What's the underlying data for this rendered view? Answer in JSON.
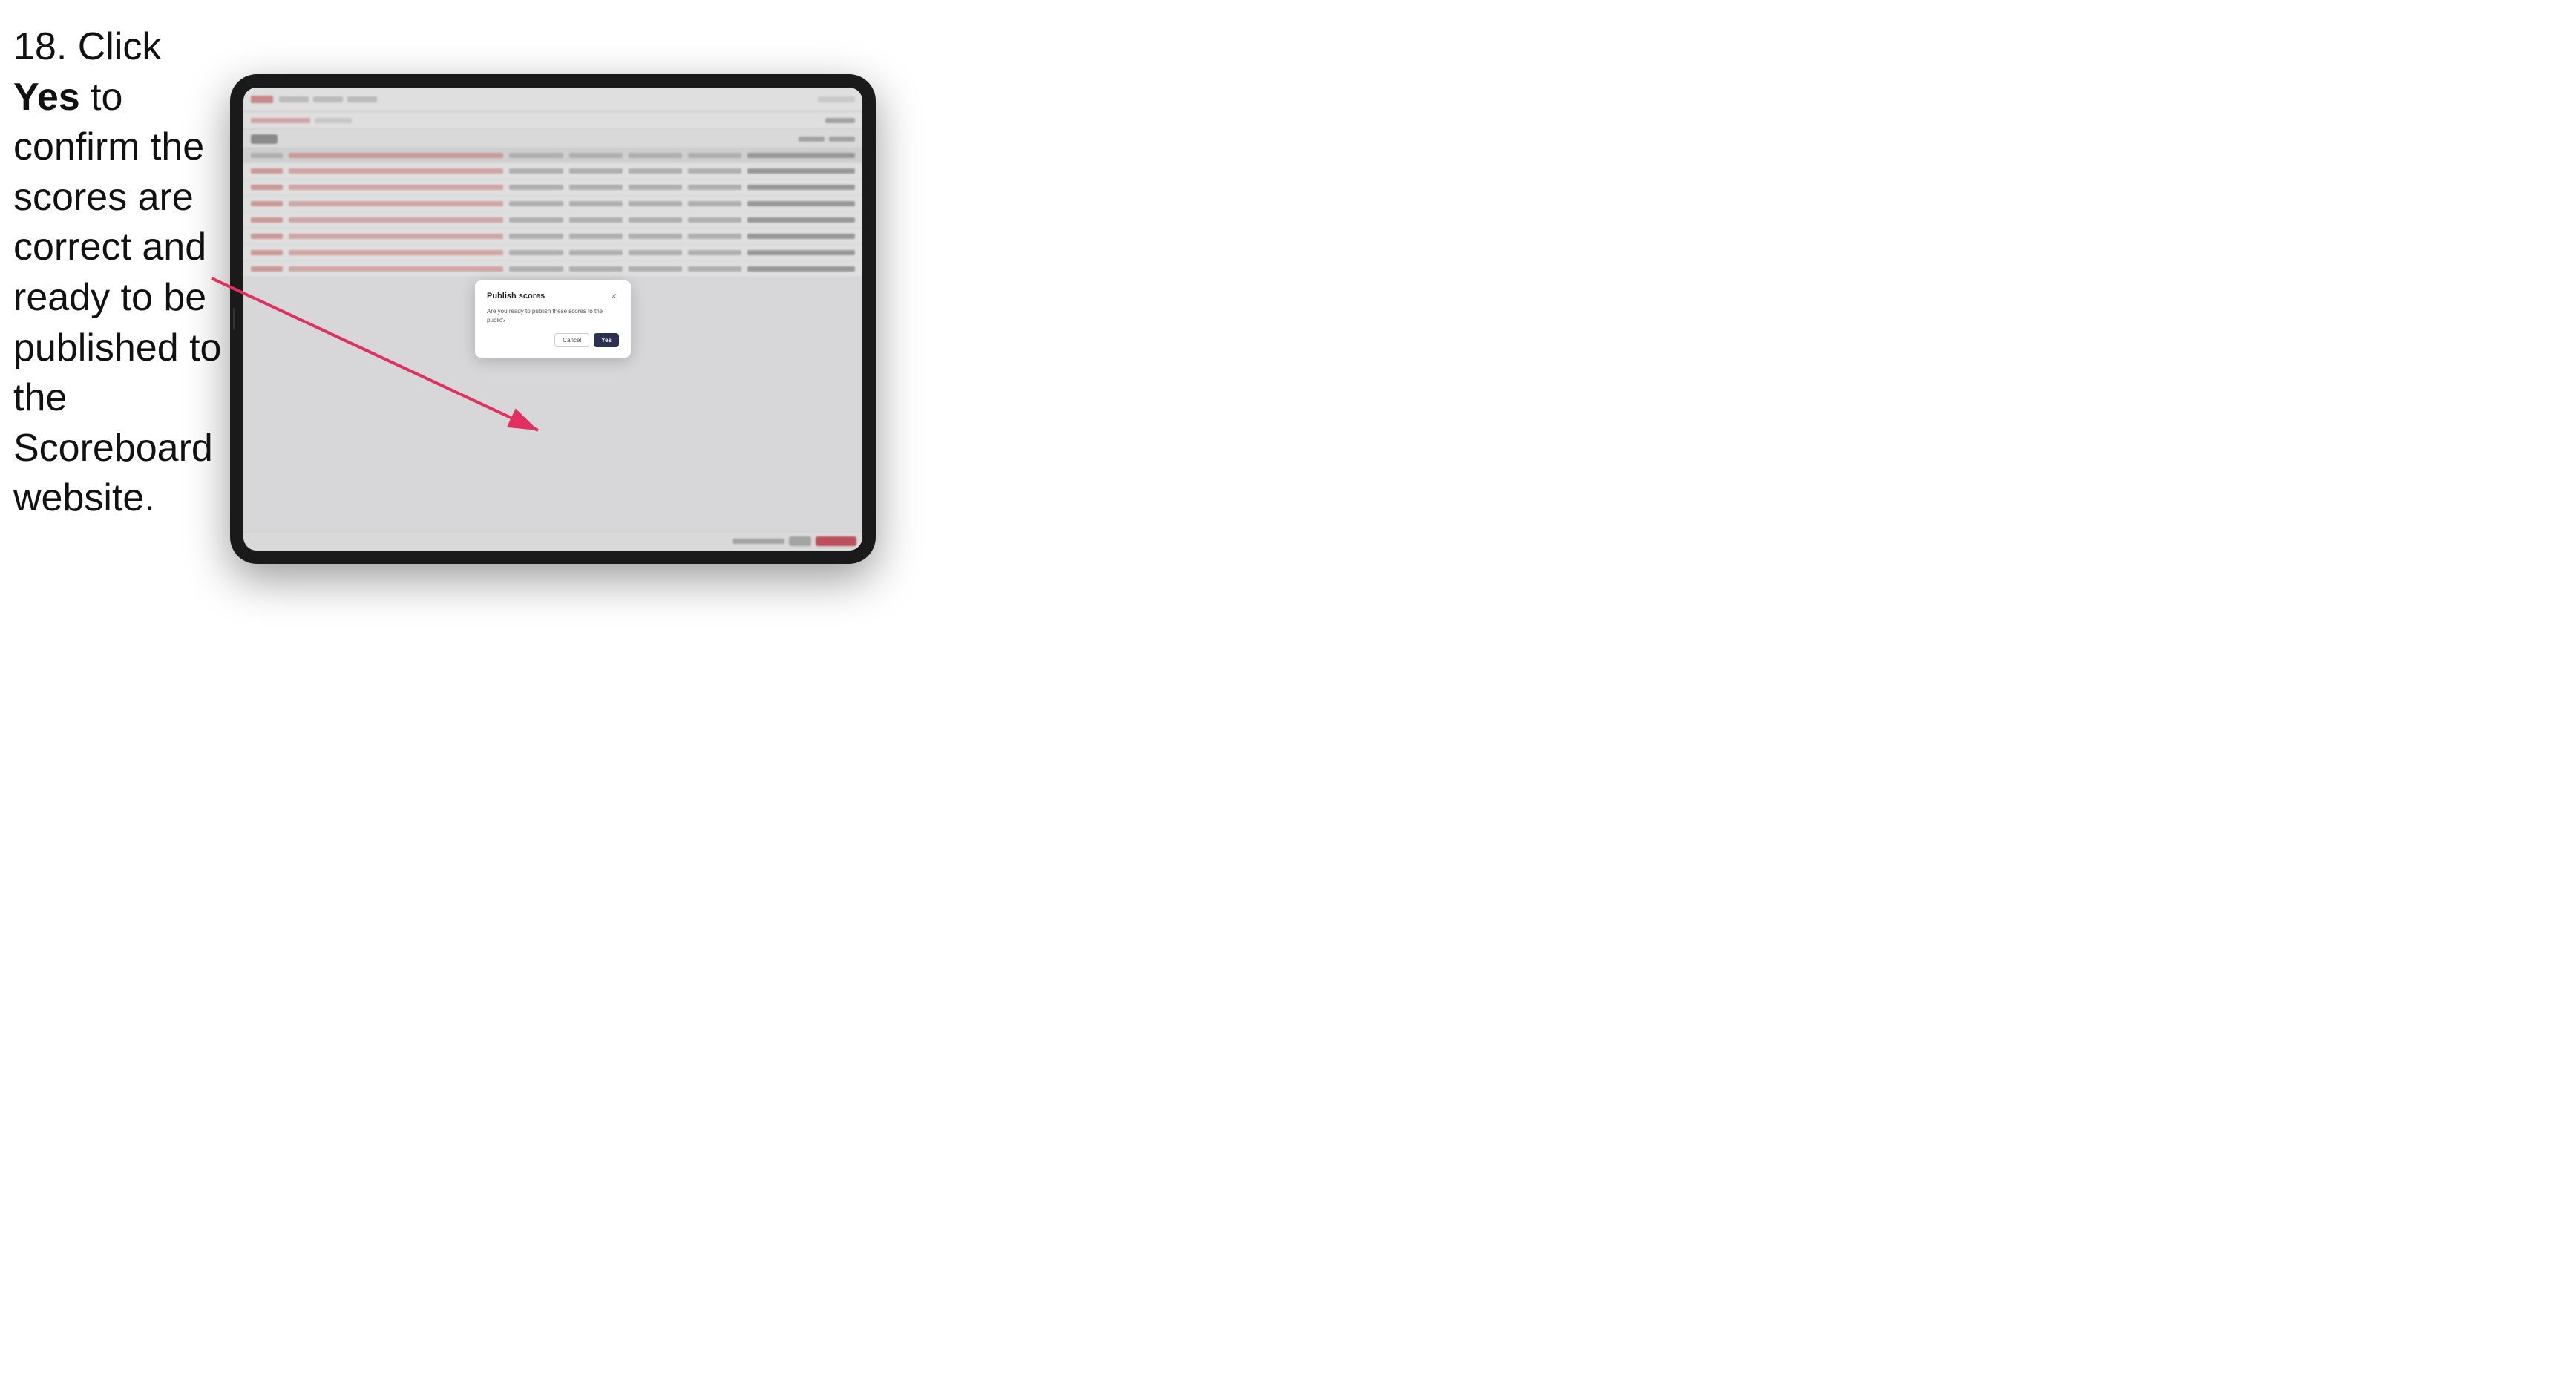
{
  "instruction": {
    "step_number": "18.",
    "text_pre": " Click ",
    "text_bold": "Yes",
    "text_post": " to confirm the scores are correct and ready to be published to the Scoreboard website."
  },
  "dialog": {
    "title": "Publish scores",
    "body": "Are you ready to publish these scores to the public?",
    "cancel_label": "Cancel",
    "yes_label": "Yes",
    "close_icon": "✕"
  },
  "app": {
    "rows": [
      {
        "cells": [
          {
            "type": "name"
          },
          {
            "type": "number"
          },
          {
            "type": "number"
          },
          {
            "type": "number"
          },
          {
            "type": "bold"
          }
        ]
      },
      {
        "cells": [
          {
            "type": "name"
          },
          {
            "type": "number"
          },
          {
            "type": "number"
          },
          {
            "type": "number"
          },
          {
            "type": "bold"
          }
        ]
      },
      {
        "cells": [
          {
            "type": "name"
          },
          {
            "type": "number"
          },
          {
            "type": "number"
          },
          {
            "type": "number"
          },
          {
            "type": "bold"
          }
        ]
      },
      {
        "cells": [
          {
            "type": "name"
          },
          {
            "type": "number"
          },
          {
            "type": "number"
          },
          {
            "type": "number"
          },
          {
            "type": "bold"
          }
        ]
      },
      {
        "cells": [
          {
            "type": "name"
          },
          {
            "type": "number"
          },
          {
            "type": "number"
          },
          {
            "type": "number"
          },
          {
            "type": "bold"
          }
        ]
      },
      {
        "cells": [
          {
            "type": "name"
          },
          {
            "type": "number"
          },
          {
            "type": "number"
          },
          {
            "type": "number"
          },
          {
            "type": "bold"
          }
        ]
      },
      {
        "cells": [
          {
            "type": "name"
          },
          {
            "type": "number"
          },
          {
            "type": "number"
          },
          {
            "type": "number"
          },
          {
            "type": "bold"
          }
        ]
      }
    ]
  }
}
